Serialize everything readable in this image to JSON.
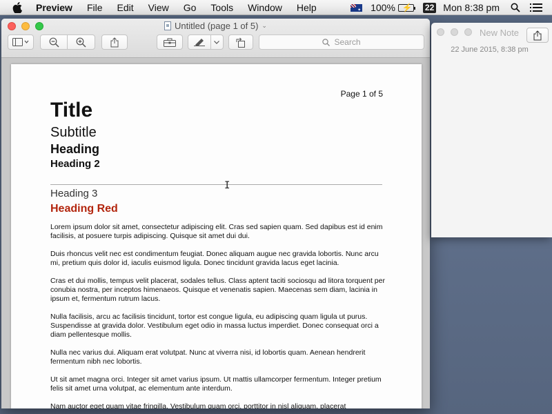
{
  "menubar": {
    "app_name": "Preview",
    "items": [
      "File",
      "Edit",
      "View",
      "Go",
      "Tools",
      "Window",
      "Help"
    ],
    "battery_percent": "100%",
    "date_badge": "22",
    "clock": "Mon 8:38 pm"
  },
  "preview": {
    "window_title": "Untitled (page 1 of 5)",
    "search_placeholder": "Search",
    "page": {
      "page_number": "Page 1 of 5",
      "title": "Title",
      "subtitle": "Subtitle",
      "heading": "Heading",
      "heading2": "Heading 2",
      "heading3": "Heading 3",
      "heading_red": "Heading Red",
      "paragraphs": [
        "Lorem ipsum dolor sit amet, consectetur adipiscing elit. Cras sed sapien quam. Sed dapibus est id enim facilisis, at posuere turpis adipiscing. Quisque sit amet dui dui.",
        "Duis rhoncus velit nec est condimentum feugiat. Donec aliquam augue nec gravida lobortis. Nunc arcu mi, pretium quis dolor id, iaculis euismod ligula. Donec tincidunt gravida lacus eget lacinia.",
        "Cras et dui mollis, tempus velit placerat, sodales tellus. Class aptent taciti sociosqu ad litora torquent per conubia nostra, per inceptos himenaeos. Quisque et venenatis sapien. Maecenas sem diam, lacinia in ipsum et, fermentum rutrum lacus.",
        "Nulla facilisis, arcu ac facilisis tincidunt, tortor est congue ligula, eu adipiscing quam ligula ut purus. Suspendisse at gravida dolor. Vestibulum eget odio in massa luctus imperdiet. Donec consequat orci a diam pellentesque mollis.",
        "Nulla nec varius dui. Aliquam erat volutpat. Nunc at viverra nisi, id lobortis quam. Aenean hendrerit fermentum nibh nec lobortis.",
        "Ut sit amet magna orci. Integer sit amet varius ipsum. Ut mattis ullamcorper fermentum. Integer pretium felis sit amet urna volutpat, ac elementum ante interdum.",
        "Nam auctor eget quam vitae fringilla. Vestibulum quam orci, porttitor in nisl aliquam, placerat"
      ]
    }
  },
  "note": {
    "title": "New Note",
    "date": "22 June 2015, 8:38 pm"
  },
  "colors": {
    "heading_red": "#b3260e",
    "desktop": "#5a6a85"
  },
  "icons": {
    "apple": "apple-icon",
    "search": "search-icon",
    "share": "share-icon",
    "sidebar": "sidebar-icon",
    "zoom_out": "zoom-out-icon",
    "zoom_in": "zoom-in-icon",
    "toolbox": "toolbox-icon",
    "markup": "pen-icon",
    "rotate": "rotate-icon",
    "list": "list-icon"
  }
}
